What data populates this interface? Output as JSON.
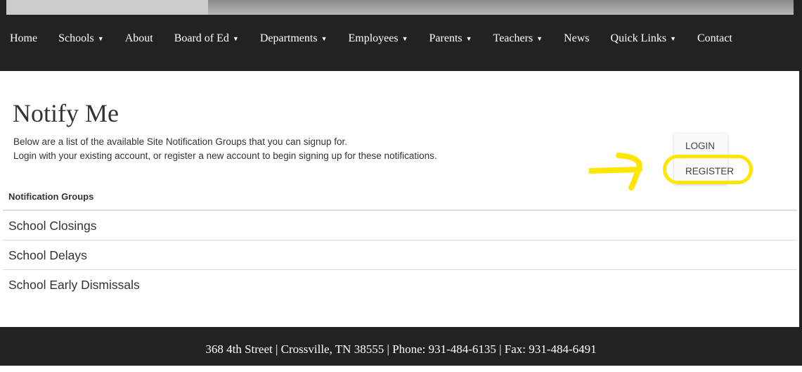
{
  "nav": {
    "items": [
      {
        "label": "Home",
        "dropdown": false
      },
      {
        "label": "Schools",
        "dropdown": true
      },
      {
        "label": "About",
        "dropdown": false
      },
      {
        "label": "Board of Ed",
        "dropdown": true
      },
      {
        "label": "Departments",
        "dropdown": true
      },
      {
        "label": "Employees",
        "dropdown": true
      },
      {
        "label": "Parents",
        "dropdown": true
      },
      {
        "label": "Teachers",
        "dropdown": true
      },
      {
        "label": "News",
        "dropdown": false
      },
      {
        "label": "Quick Links",
        "dropdown": true
      },
      {
        "label": "Contact",
        "dropdown": false
      }
    ]
  },
  "page": {
    "title": "Notify Me",
    "intro_line1": "Below are a list of the available Site Notification Groups that you can signup for.",
    "intro_line2": "Login with your existing account, or register a new account to begin signing up for these notifications.",
    "login_label": "LOGIN",
    "register_label": "REGISTER",
    "groups_header": "Notification Groups",
    "groups": [
      "School Closings",
      "School Delays",
      "School Early Dismissals"
    ]
  },
  "annotation_color": "#ffe600",
  "footer": {
    "text": "368 4th Street | Crossville, TN 38555 | Phone: 931-484-6135 | Fax: 931-484-6491"
  }
}
